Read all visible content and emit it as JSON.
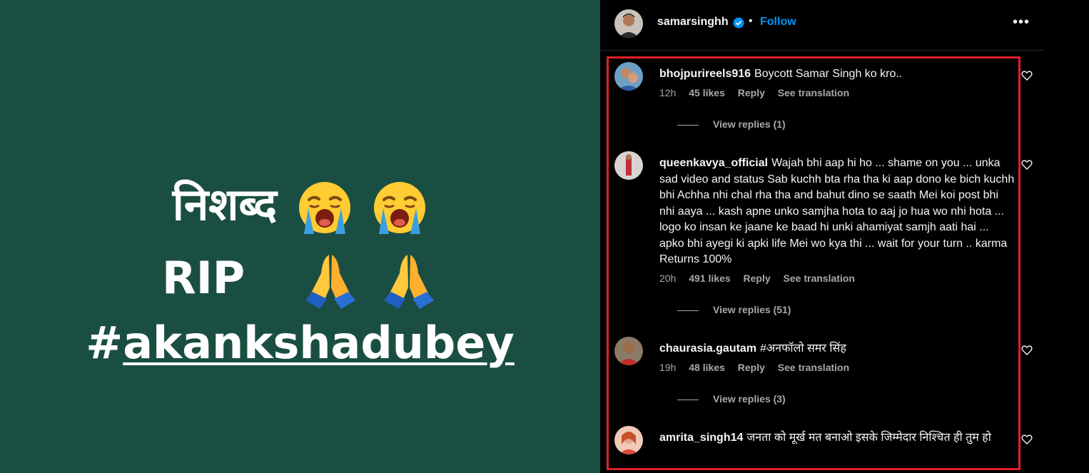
{
  "story": {
    "line1_text": "निशब्द",
    "line2_text": "RIP",
    "line3_hash": "#",
    "line3_tag": "akankshadubey",
    "line1_emoji": "loudly-crying-face-emoji",
    "line2_emoji": "folded-hands-emoji",
    "background_color": "#1b4e42"
  },
  "header": {
    "username": "samarsinghh",
    "separator": "•",
    "follow_label": "Follow",
    "more_label": "•••"
  },
  "comments": [
    {
      "username": "bhojpurireels916",
      "text": "Boycott Samar Singh ko kro..",
      "time": "12h",
      "likes": "45 likes",
      "reply": "Reply",
      "translate": "See translation",
      "view_replies": "View replies (1)"
    },
    {
      "username": "queenkavya_official",
      "text": "Wajah bhi aap hi ho ... shame on you ... unka sad video and status Sab kuchh bta rha tha ki aap dono ke bich kuchh bhi Achha nhi chal rha tha and bahut dino se saath Mei koi post bhi nhi aaya ... kash apne unko samjha hota to aaj jo hua wo nhi hota ... logo ko insan ke jaane ke baad hi unki ahamiyat samjh aati hai ... apko bhi ayegi ki apki life Mei wo kya thi ... wait for your turn .. karma Returns 100%",
      "time": "20h",
      "likes": "491 likes",
      "reply": "Reply",
      "translate": "See translation",
      "view_replies": "View replies (51)"
    },
    {
      "username": "chaurasia.gautam",
      "text": "#अनफॉलो समर सिंह",
      "time": "19h",
      "likes": "48 likes",
      "reply": "Reply",
      "translate": "See translation",
      "view_replies": "View replies (3)"
    },
    {
      "username": "amrita_singh14",
      "text": "जनता को मूर्ख मत बनाओ इसके जिम्मेदार निश्चित ही तुम हो"
    }
  ],
  "colors": {
    "accent": "#0095f6",
    "highlight_border": "#e0202a",
    "muted_text": "#a8a8a8"
  }
}
